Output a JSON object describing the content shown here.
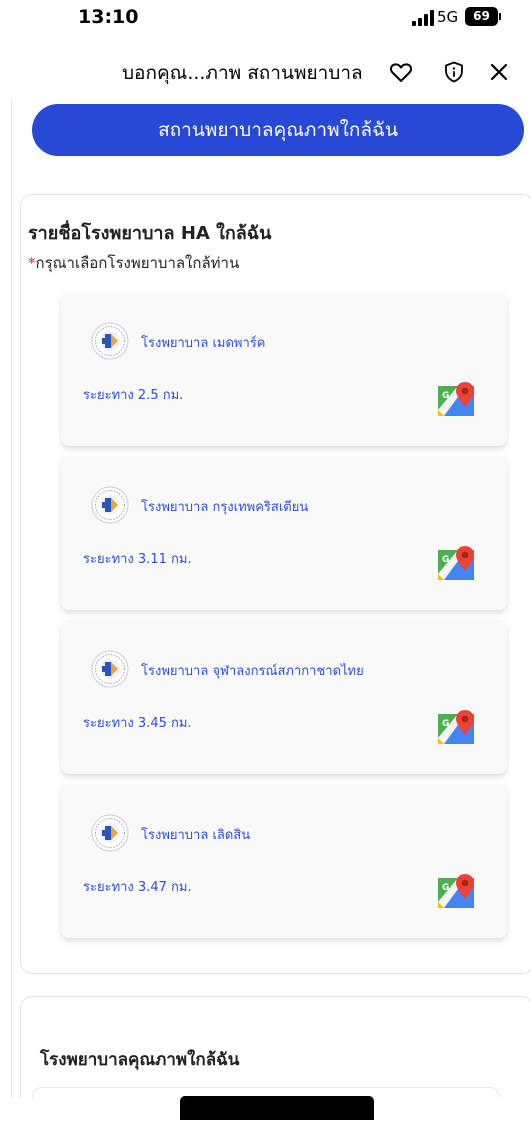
{
  "status_bar": {
    "time": "13:10",
    "network": "5G",
    "battery": "69"
  },
  "browser": {
    "title": "บอกคุณ...ภาพ สถานพยาบาล",
    "icons": [
      "heart-icon",
      "shield-info-icon",
      "close-icon"
    ]
  },
  "primary_button": {
    "label": "สถานพยาบาลคุณภาพใกล้ฉัน"
  },
  "ha_section": {
    "title": "รายชื่อโรงพยาบาล HA ใกล้ฉัน",
    "required_mark": "*",
    "subtitle": "กรุณาเลือกโรงพยาบาลใกล้ท่าน",
    "hospitals": [
      {
        "name": "โรงพยาบาล เมดพาร์ค",
        "distance": "ระยะทาง 2.5 กม."
      },
      {
        "name": "โรงพยาบาล กรุงเทพคริสเตียน",
        "distance": "ระยะทาง 3.11 กม."
      },
      {
        "name": "โรงพยาบาล จุฬาลงกรณ์สภากาชาดไทย",
        "distance": "ระยะทาง 3.45 กม."
      },
      {
        "name": "โรงพยาบาล เลิดสิน",
        "distance": "ระยะทาง 3.47 กม."
      }
    ]
  },
  "quality_section": {
    "title": "โรงพยาบาลคุณภาพใกล้ฉัน"
  },
  "colors": {
    "primary": "#2749d6",
    "link": "#2c4fd8",
    "required": "#d93025"
  }
}
